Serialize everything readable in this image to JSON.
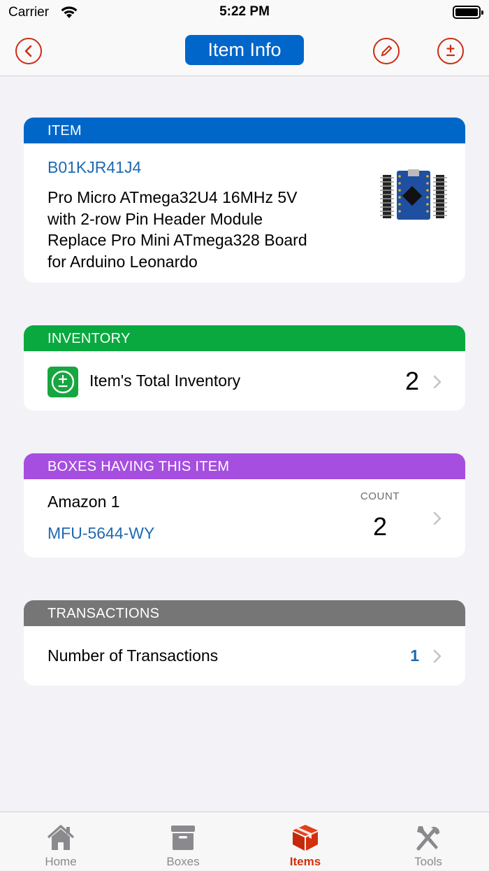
{
  "status_bar": {
    "carrier": "Carrier",
    "time": "5:22 PM"
  },
  "nav": {
    "title": "Item Info"
  },
  "item_card": {
    "header": "ITEM",
    "code": "B01KJR41J4",
    "title_lines": [
      "Pro Micro ATmega32U4 16MHz 5V",
      "with 2-row Pin Header Module",
      "Replace Pro Mini ATmega328 Board",
      "for Arduino Leonardo"
    ],
    "header_color": "#0067c9"
  },
  "inventory_card": {
    "header": "INVENTORY",
    "label": "Item's Total Inventory",
    "value": "2",
    "header_color": "#0aa940"
  },
  "boxes_card": {
    "header": "BOXES HAVING THIS ITEM",
    "box_name": "Amazon 1",
    "box_code": "MFU-5644-WY",
    "count_label": "COUNT",
    "count_value": "2",
    "header_color": "#a54ee0"
  },
  "transactions_card": {
    "header": "TRANSACTIONS",
    "label": "Number of Transactions",
    "value": "1",
    "header_color": "#767676"
  },
  "tab_bar": {
    "tabs": [
      {
        "label": "Home",
        "icon": "home-icon"
      },
      {
        "label": "Boxes",
        "icon": "archive-box-icon"
      },
      {
        "label": "Items",
        "icon": "cube-icon",
        "active": true
      },
      {
        "label": "Tools",
        "icon": "tools-icon"
      }
    ],
    "active_color": "#d2310b",
    "inactive_color": "#8a8a8e"
  }
}
